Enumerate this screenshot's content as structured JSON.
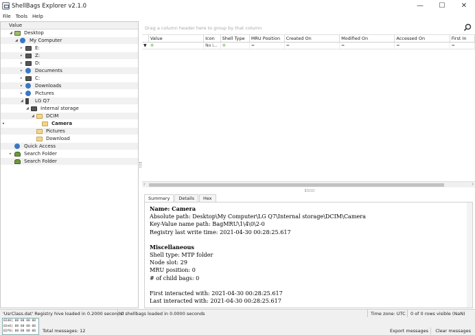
{
  "window": {
    "title": "ShellBags Explorer v2.1.0",
    "minimize": "—",
    "maximize": "☐",
    "close": "✕"
  },
  "menu": [
    "File",
    "Tools",
    "Help"
  ],
  "tree": {
    "header": "Value",
    "items": [
      {
        "label": "Desktop",
        "icon": "home-icon"
      },
      {
        "label": "My Computer",
        "icon": "gear-icon"
      },
      {
        "label": "E:",
        "icon": "drive-icon"
      },
      {
        "label": "Z:",
        "icon": "drive-icon"
      },
      {
        "label": "D:",
        "icon": "drive-icon"
      },
      {
        "label": "Documents",
        "icon": "gear-icon"
      },
      {
        "label": "C:",
        "icon": "drive-icon"
      },
      {
        "label": "Downloads",
        "icon": "gear-icon"
      },
      {
        "label": "Pictures",
        "icon": "gear-icon"
      },
      {
        "label": "LG Q7",
        "icon": "phone-icon"
      },
      {
        "label": "Internal storage",
        "icon": "drive-icon"
      },
      {
        "label": "DCIM",
        "icon": "folder-icon"
      },
      {
        "label": "Camera",
        "icon": "folder-icon"
      },
      {
        "label": "Pictures",
        "icon": "folder-icon"
      },
      {
        "label": "Download",
        "icon": "folder-icon"
      },
      {
        "label": "Quick Access",
        "icon": "gear-icon"
      },
      {
        "label": "Search Folder",
        "icon": "user-icon"
      },
      {
        "label": "Search Folder",
        "icon": "user-icon"
      }
    ]
  },
  "grid": {
    "group_hint": "Drag a column header here to group by that column",
    "columns": [
      "Value",
      "Icon",
      "Shell Type",
      "MRU Position",
      "Created On",
      "Modified On",
      "Accessed On",
      "First In"
    ],
    "filter": [
      "",
      "No i...",
      "",
      "=",
      "=",
      "=",
      "=",
      "="
    ]
  },
  "tabs": [
    "Summary",
    "Details",
    "Hex"
  ],
  "summary": {
    "name": "Name: Camera",
    "absolute_path": "Absolute path: Desktop\\My Computer\\LG Q7\\Internal storage\\DCIM\\Camera",
    "key_value_path": "Key-Value name path: BagMRU\\1\\4\\0\\2-0",
    "registry_write": "Registry last write time: 2021-04-30 00:28:25.617",
    "misc_header": "Miscellaneous",
    "shell_type": "Shell type: MTP folder",
    "node_slot": "Node slot: 29",
    "mru_position": "MRU position: 0",
    "child_bags": "# of child bags: 0",
    "first_interacted": "First interacted with: 2021-04-30 00:28:25.617",
    "last_interacted": "Last interacted with: 2021-04-30 00:28:25.617"
  },
  "status": {
    "hive": "'UsrClass.dat' Registry hive loaded in 0.2000 seconds!",
    "bags": "0 shellbags loaded in 0.0000 seconds",
    "timezone": "Time zone: UTC",
    "rows": "0 of 0 rows visible (NaN)"
  },
  "bottom": {
    "hex_lines": [
      "02d0| 00 00 00 00",
      "02e0| 00 00 00 00",
      "02f0| 00 00 00 00"
    ],
    "total_messages": "Total messages: 12",
    "export": "Export messages",
    "clear": "Clear messages"
  }
}
